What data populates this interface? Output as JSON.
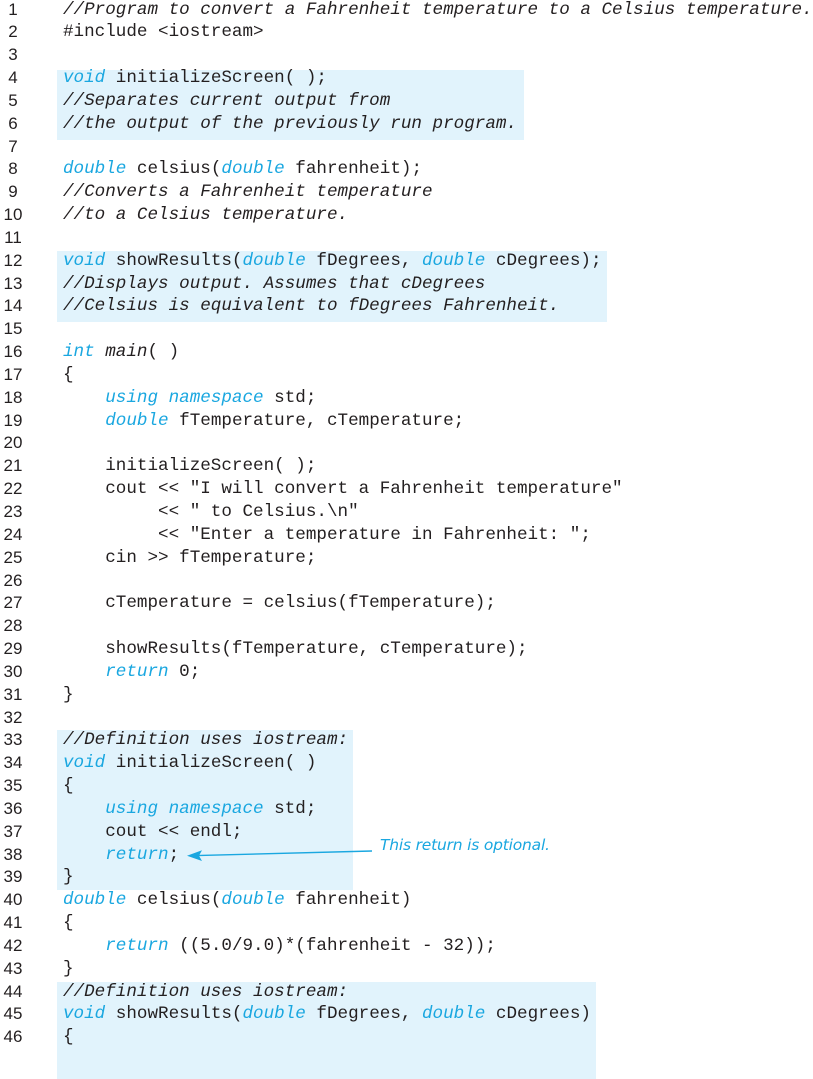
{
  "listing": {
    "colors": {
      "keyword": "#1aa7e0",
      "highlight": "#e1f3fc",
      "text": "#231f20",
      "annotation": "#1aa7e0"
    },
    "highlight_blocks": [
      {
        "from_line": 4,
        "to_line": 6,
        "label": "initializeScreen-declaration"
      },
      {
        "from_line": 12,
        "to_line": 14,
        "label": "showResults-declaration"
      },
      {
        "from_line": 33,
        "to_line": 39,
        "label": "initializeScreen-definition"
      },
      {
        "from_line": 44,
        "to_line": 46,
        "label": "showResults-definition"
      }
    ],
    "lines": [
      {
        "n": "1",
        "tokens": [
          {
            "t": "//Program to convert a Fahrenheit temperature to a Celsius temperature.",
            "k": "comment"
          }
        ]
      },
      {
        "n": "2",
        "tokens": [
          {
            "t": "#include <iostream>",
            "k": "plain"
          }
        ]
      },
      {
        "n": "3",
        "tokens": []
      },
      {
        "n": "4",
        "tokens": [
          {
            "t": "void",
            "k": "kw"
          },
          {
            "t": " initializeScreen( );",
            "k": "plain"
          }
        ]
      },
      {
        "n": "5",
        "tokens": [
          {
            "t": "//Separates current output from",
            "k": "comment"
          }
        ]
      },
      {
        "n": "6",
        "tokens": [
          {
            "t": "//the output of the previously run program.",
            "k": "comment"
          }
        ]
      },
      {
        "n": "7",
        "tokens": []
      },
      {
        "n": "8",
        "tokens": [
          {
            "t": "double",
            "k": "kw"
          },
          {
            "t": " celsius(",
            "k": "plain"
          },
          {
            "t": "double",
            "k": "kw"
          },
          {
            "t": " fahrenheit);",
            "k": "plain"
          }
        ]
      },
      {
        "n": "9",
        "tokens": [
          {
            "t": "//Converts a Fahrenheit temperature",
            "k": "comment"
          }
        ]
      },
      {
        "n": "10",
        "tokens": [
          {
            "t": "//to a Celsius temperature.",
            "k": "comment"
          }
        ]
      },
      {
        "n": "11",
        "tokens": []
      },
      {
        "n": "12",
        "tokens": [
          {
            "t": "void",
            "k": "kw"
          },
          {
            "t": " showResults(",
            "k": "plain"
          },
          {
            "t": "double",
            "k": "kw"
          },
          {
            "t": " fDegrees, ",
            "k": "plain"
          },
          {
            "t": "double",
            "k": "kw"
          },
          {
            "t": " cDegrees);",
            "k": "plain"
          }
        ]
      },
      {
        "n": "13",
        "tokens": [
          {
            "t": "//Displays output. Assumes that cDegrees",
            "k": "comment"
          }
        ]
      },
      {
        "n": "14",
        "tokens": [
          {
            "t": "//Celsius is equivalent to fDegrees Fahrenheit.",
            "k": "comment"
          }
        ]
      },
      {
        "n": "15",
        "tokens": []
      },
      {
        "n": "16",
        "tokens": [
          {
            "t": "int",
            "k": "kw"
          },
          {
            "t": " ",
            "k": "plain"
          },
          {
            "t": "main",
            "k": "italic"
          },
          {
            "t": "( )",
            "k": "plain"
          }
        ]
      },
      {
        "n": "17",
        "tokens": [
          {
            "t": "{",
            "k": "plain"
          }
        ]
      },
      {
        "n": "18",
        "tokens": [
          {
            "t": "    ",
            "k": "plain"
          },
          {
            "t": "using namespace",
            "k": "kw"
          },
          {
            "t": " std;",
            "k": "plain"
          }
        ]
      },
      {
        "n": "19",
        "tokens": [
          {
            "t": "    ",
            "k": "plain"
          },
          {
            "t": "double",
            "k": "kw"
          },
          {
            "t": " fTemperature, cTemperature;",
            "k": "plain"
          }
        ]
      },
      {
        "n": "20",
        "tokens": []
      },
      {
        "n": "21",
        "tokens": [
          {
            "t": "    initializeScreen( );",
            "k": "plain"
          }
        ]
      },
      {
        "n": "22",
        "tokens": [
          {
            "t": "    cout << \"I will convert a Fahrenheit temperature\"",
            "k": "plain"
          }
        ]
      },
      {
        "n": "23",
        "tokens": [
          {
            "t": "         << \" to Celsius.\\n\"",
            "k": "plain"
          }
        ]
      },
      {
        "n": "24",
        "tokens": [
          {
            "t": "         << \"Enter a temperature in Fahrenheit: \";",
            "k": "plain"
          }
        ]
      },
      {
        "n": "25",
        "tokens": [
          {
            "t": "    cin >> fTemperature;",
            "k": "plain"
          }
        ]
      },
      {
        "n": "26",
        "tokens": []
      },
      {
        "n": "27",
        "tokens": [
          {
            "t": "    cTemperature = celsius(fTemperature);",
            "k": "plain"
          }
        ]
      },
      {
        "n": "28",
        "tokens": []
      },
      {
        "n": "29",
        "tokens": [
          {
            "t": "    showResults(fTemperature, cTemperature);",
            "k": "plain"
          }
        ]
      },
      {
        "n": "30",
        "tokens": [
          {
            "t": "    ",
            "k": "plain"
          },
          {
            "t": "return",
            "k": "kw"
          },
          {
            "t": " 0;",
            "k": "plain"
          }
        ]
      },
      {
        "n": "31",
        "tokens": [
          {
            "t": "}",
            "k": "plain"
          }
        ]
      },
      {
        "n": "32",
        "tokens": []
      },
      {
        "n": "33",
        "tokens": [
          {
            "t": "//Definition uses iostream:",
            "k": "comment"
          }
        ]
      },
      {
        "n": "34",
        "tokens": [
          {
            "t": "void",
            "k": "kw"
          },
          {
            "t": " initializeScreen( )",
            "k": "plain"
          }
        ]
      },
      {
        "n": "35",
        "tokens": [
          {
            "t": "{",
            "k": "plain"
          }
        ]
      },
      {
        "n": "36",
        "tokens": [
          {
            "t": "    ",
            "k": "plain"
          },
          {
            "t": "using namespace",
            "k": "kw"
          },
          {
            "t": " std;",
            "k": "plain"
          }
        ]
      },
      {
        "n": "37",
        "tokens": [
          {
            "t": "    cout << endl;",
            "k": "plain"
          }
        ]
      },
      {
        "n": "38",
        "tokens": [
          {
            "t": "    ",
            "k": "plain"
          },
          {
            "t": "return",
            "k": "kw"
          },
          {
            "t": ";",
            "k": "plain"
          }
        ]
      },
      {
        "n": "39",
        "tokens": [
          {
            "t": "}",
            "k": "plain"
          }
        ]
      },
      {
        "n": "40",
        "tokens": [
          {
            "t": "double",
            "k": "kw"
          },
          {
            "t": " celsius(",
            "k": "plain"
          },
          {
            "t": "double",
            "k": "kw"
          },
          {
            "t": " fahrenheit)",
            "k": "plain"
          }
        ]
      },
      {
        "n": "41",
        "tokens": [
          {
            "t": "{",
            "k": "plain"
          }
        ]
      },
      {
        "n": "42",
        "tokens": [
          {
            "t": "    ",
            "k": "plain"
          },
          {
            "t": "return",
            "k": "kw"
          },
          {
            "t": " ((5.0/9.0)*(fahrenheit - 32));",
            "k": "plain"
          }
        ]
      },
      {
        "n": "43",
        "tokens": [
          {
            "t": "}",
            "k": "plain"
          }
        ]
      },
      {
        "n": "44",
        "tokens": [
          {
            "t": "//Definition uses iostream:",
            "k": "comment"
          }
        ]
      },
      {
        "n": "45",
        "tokens": [
          {
            "t": "void",
            "k": "kw"
          },
          {
            "t": " showResults(",
            "k": "plain"
          },
          {
            "t": "double",
            "k": "kw"
          },
          {
            "t": " fDegrees, ",
            "k": "plain"
          },
          {
            "t": "double",
            "k": "kw"
          },
          {
            "t": " cDegrees)",
            "k": "plain"
          }
        ]
      },
      {
        "n": "46",
        "tokens": [
          {
            "t": "{",
            "k": "plain"
          }
        ]
      }
    ],
    "annotation": {
      "text": "This return is optional.",
      "points_to_line": 38
    }
  }
}
